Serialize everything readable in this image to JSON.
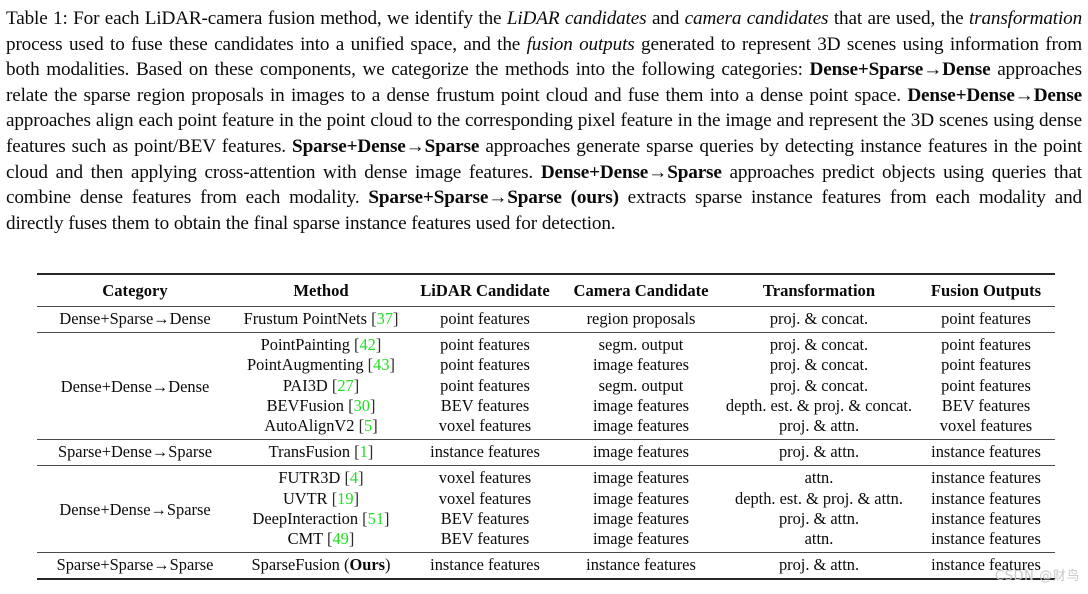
{
  "caption": {
    "label": "Table 1:",
    "segments": [
      {
        "t": "Table 1: For each LiDAR-camera fusion method, we identify the ",
        "s": "normal"
      },
      {
        "t": "LiDAR candidates",
        "s": "italic"
      },
      {
        "t": " and ",
        "s": "normal"
      },
      {
        "t": "camera candidates",
        "s": "italic"
      },
      {
        "t": " that are used, the ",
        "s": "normal"
      },
      {
        "t": "transformation",
        "s": "italic"
      },
      {
        "t": " process used to fuse these candidates into a unified space, and the ",
        "s": "normal"
      },
      {
        "t": "fusion outputs",
        "s": "italic"
      },
      {
        "t": " generated to represent 3D scenes using information from both modalities. Based on these components, we categorize the methods into the following categories: ",
        "s": "normal"
      },
      {
        "t": "Dense+Sparse→Dense",
        "s": "bold"
      },
      {
        "t": " approaches relate the sparse region proposals in images to a dense frustum point cloud and fuse them into a dense point space. ",
        "s": "normal"
      },
      {
        "t": "Dense+Dense→Dense",
        "s": "bold"
      },
      {
        "t": " approaches align each point feature in the point cloud to the corresponding pixel feature in the image and represent the 3D scenes using dense features such as point/BEV features. ",
        "s": "normal"
      },
      {
        "t": "Sparse+Dense→Sparse",
        "s": "bold"
      },
      {
        "t": " approaches generate sparse queries by detecting instance features in the point cloud and then applying cross-attention with dense image features. ",
        "s": "normal"
      },
      {
        "t": "Dense+Dense→Sparse",
        "s": "bold"
      },
      {
        "t": " approaches predict objects using queries that combine dense features from each modality. ",
        "s": "normal"
      },
      {
        "t": "Sparse+Sparse→Sparse (ours)",
        "s": "bold"
      },
      {
        "t": " extracts sparse instance features from each modality and directly fuses them to obtain the final sparse instance features used for detection.",
        "s": "normal"
      }
    ]
  },
  "table": {
    "columns": [
      "Category",
      "Method",
      "LiDAR Candidate",
      "Camera Candidate",
      "Transformation",
      "Fusion Outputs"
    ],
    "groups": [
      {
        "category": "Dense+Sparse→Dense",
        "rows": [
          {
            "method": "Frustum PointNets",
            "cite": "37",
            "lidar": "point features",
            "camera": "region proposals",
            "transformation": "proj. & concat.",
            "output": "point features"
          }
        ]
      },
      {
        "category": "Dense+Dense→Dense",
        "rows": [
          {
            "method": "PointPainting",
            "cite": "42",
            "lidar": "point features",
            "camera": "segm. output",
            "transformation": "proj. & concat.",
            "output": "point features"
          },
          {
            "method": "PointAugmenting",
            "cite": "43",
            "lidar": "point features",
            "camera": "image features",
            "transformation": "proj. & concat.",
            "output": "point features"
          },
          {
            "method": "PAI3D",
            "cite": "27",
            "lidar": "point features",
            "camera": "segm. output",
            "transformation": "proj. & concat.",
            "output": "point features"
          },
          {
            "method": "BEVFusion",
            "cite": "30",
            "lidar": "BEV features",
            "camera": "image features",
            "transformation": "depth. est. & proj. & concat.",
            "output": "BEV features"
          },
          {
            "method": "AutoAlignV2",
            "cite": "5",
            "lidar": "voxel features",
            "camera": "image features",
            "transformation": "proj. & attn.",
            "output": "voxel features"
          }
        ]
      },
      {
        "category": "Sparse+Dense→Sparse",
        "rows": [
          {
            "method": "TransFusion",
            "cite": "1",
            "lidar": "instance features",
            "camera": "image features",
            "transformation": "proj. & attn.",
            "output": "instance features"
          }
        ]
      },
      {
        "category": "Dense+Dense→Sparse",
        "rows": [
          {
            "method": "FUTR3D",
            "cite": "4",
            "lidar": "voxel features",
            "camera": "image features",
            "transformation": "attn.",
            "output": "instance features"
          },
          {
            "method": "UVTR",
            "cite": "19",
            "lidar": "voxel features",
            "camera": "image features",
            "transformation": "depth. est. & proj. & attn.",
            "output": "instance features"
          },
          {
            "method": "DeepInteraction",
            "cite": "51",
            "lidar": "BEV features",
            "camera": "image features",
            "transformation": "proj. & attn.",
            "output": "instance features"
          },
          {
            "method": "CMT",
            "cite": "49",
            "lidar": "BEV features",
            "camera": "image features",
            "transformation": "attn.",
            "output": "instance features"
          }
        ]
      },
      {
        "category": "Sparse+Sparse→Sparse",
        "rows": [
          {
            "method": "SparseFusion",
            "ours": "(Ours)",
            "cite": null,
            "lidar": "instance features",
            "camera": "instance features",
            "transformation": "proj. & attn.",
            "output": "instance features"
          }
        ]
      }
    ]
  },
  "watermark": {
    "text": "CSDN @财鸟"
  },
  "colors": {
    "citation": "#22e022",
    "bracket": "#2b2b2b",
    "rule": "#262626",
    "text": "#0a0a0a",
    "watermark": "#c9c9c9"
  }
}
